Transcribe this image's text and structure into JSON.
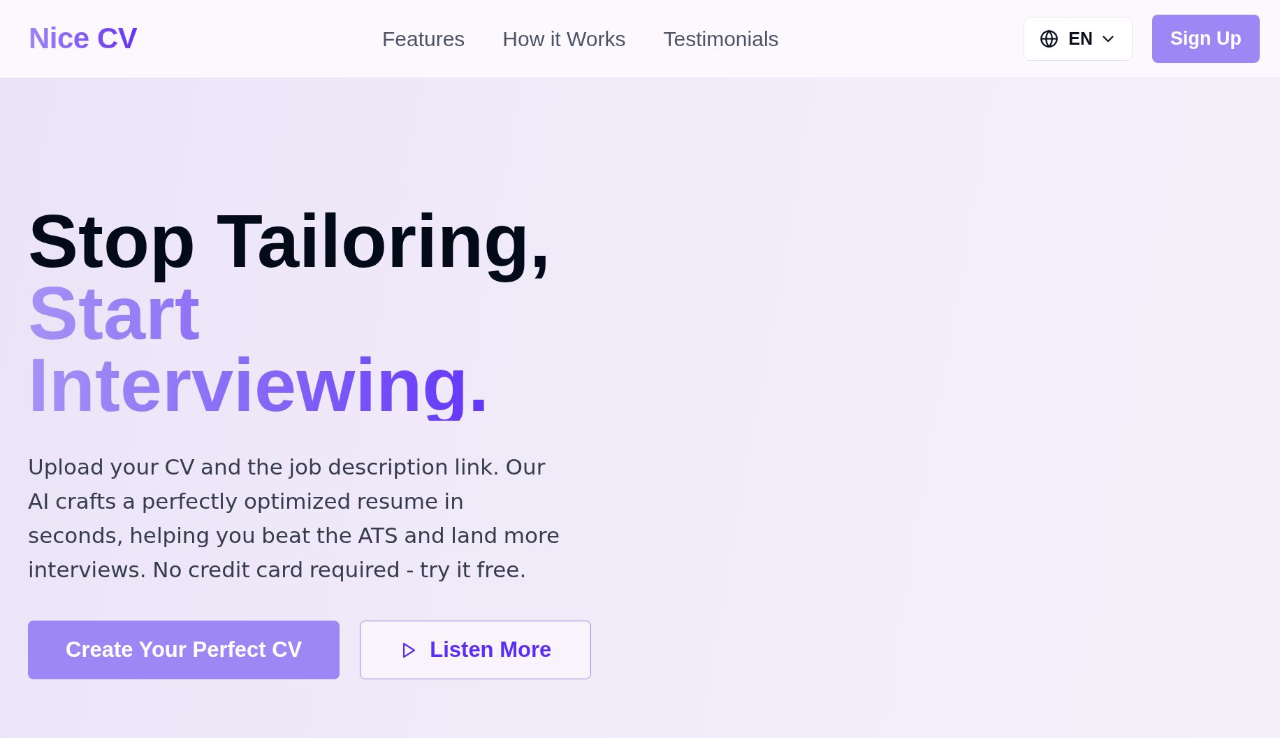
{
  "header": {
    "logo": "Nice CV",
    "nav": [
      {
        "label": "Features"
      },
      {
        "label": "How it Works"
      },
      {
        "label": "Testimonials"
      }
    ],
    "language": {
      "label": "EN"
    },
    "sign_up": "Sign Up"
  },
  "hero": {
    "headline": "Stop Tailoring,",
    "headline_highlight": "Start Interviewing.",
    "description": "Upload your CV and the job description link. Our AI crafts a perfectly optimized resume in seconds, helping you beat the ATS and land more interviews. No credit card required - try it free.",
    "buttons": [
      {
        "label": "Create Your Perfect CV",
        "kind": "primary"
      },
      {
        "label": "Listen More",
        "kind": "outline"
      }
    ]
  }
}
